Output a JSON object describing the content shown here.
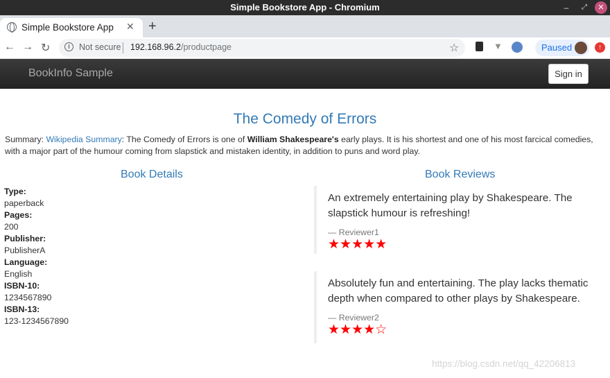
{
  "window": {
    "title": "Simple Bookstore App - Chromium"
  },
  "tab": {
    "title": "Simple Bookstore App"
  },
  "toolbar": {
    "security_label": "Not secure",
    "url_host": "192.168.96.2",
    "url_path": "/productpage",
    "profile_status": "Paused"
  },
  "navbar": {
    "brand": "BookInfo Sample",
    "signin_label": "Sign in"
  },
  "book": {
    "title": "The Comedy of Errors",
    "summary_prefix": "Summary: ",
    "summary_link": "Wikipedia Summary",
    "summary_part1": ": The Comedy of Errors is one of ",
    "summary_bold": "William Shakespeare's",
    "summary_part2": " early plays. It is his shortest and one of his most farcical comedies, with a major part of the humour coming from slapstick and mistaken identity, in addition to puns and word play."
  },
  "details": {
    "heading": "Book Details",
    "fields": [
      {
        "label": "Type:",
        "value": "paperback"
      },
      {
        "label": "Pages:",
        "value": "200"
      },
      {
        "label": "Publisher:",
        "value": "PublisherA"
      },
      {
        "label": "Language:",
        "value": "English"
      },
      {
        "label": "ISBN-10:",
        "value": "1234567890"
      },
      {
        "label": "ISBN-13:",
        "value": "123-1234567890"
      }
    ]
  },
  "reviews": {
    "heading": "Book Reviews",
    "items": [
      {
        "text": "An extremely entertaining play by Shakespeare. The slapstick humour is refreshing!",
        "reviewer": "— Reviewer1",
        "rating": 5,
        "stars": "★★★★★",
        "star_color": "#ff0000"
      },
      {
        "text": "Absolutely fun and entertaining. The play lacks thematic depth when compared to other plays by Shakespeare.",
        "reviewer": "— Reviewer2",
        "rating": 4,
        "stars": "★★★★☆",
        "star_color": "#ff0000"
      }
    ]
  },
  "watermark": "https://blog.csdn.net/qq_42206813",
  "colors": {
    "link": "#337ab7",
    "navbar": "#222222",
    "star": "#ff0000"
  }
}
